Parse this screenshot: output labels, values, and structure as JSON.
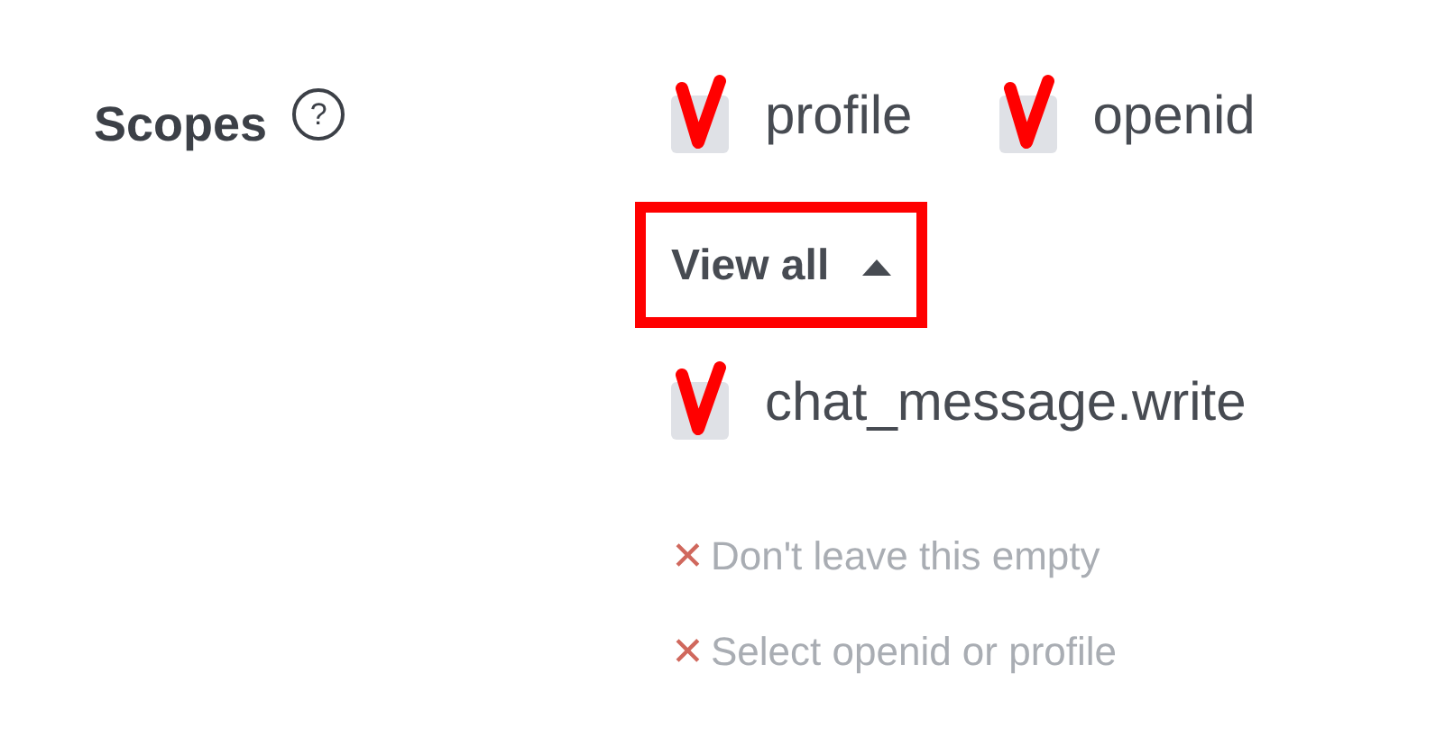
{
  "field": {
    "label": "Scopes",
    "help_icon": "?"
  },
  "scopes": [
    {
      "label": "profile",
      "checked": true
    },
    {
      "label": "openid",
      "checked": true
    }
  ],
  "view_all": {
    "label": "View all",
    "expanded": true,
    "highlighted": true
  },
  "more_scopes": [
    {
      "label": "chat_message.write",
      "checked": true
    }
  ],
  "errors": [
    {
      "icon": "✕",
      "text": "Don't leave this empty"
    },
    {
      "icon": "✕",
      "text": "Select openid or profile"
    }
  ]
}
